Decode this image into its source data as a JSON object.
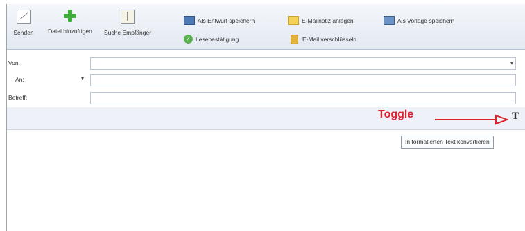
{
  "toolbar": {
    "send_label": "Senden",
    "attach_label": "Datei hinzufügen",
    "search_label": "Suche Empfänger",
    "save_draft_label": "Als Entwurf speichern",
    "read_receipt_label": "Lesebestätigung",
    "note_label": "E-Mailnotiz anlegen",
    "encrypt_label": "E-Mail verschlüsseln",
    "template_label": "Als Vorlage speichern"
  },
  "form": {
    "from_label": "Von:",
    "from_value": "",
    "to_label": "An:",
    "to_value": "",
    "subject_label": "Betreff:",
    "subject_value": ""
  },
  "annotation": {
    "toggle_label": "Toggle",
    "arrow_color": "#d9242f"
  },
  "format": {
    "icon": "text-format-icon",
    "icon_glyph": "T",
    "tooltip": "In formatierten Text konvertieren"
  },
  "icons": {
    "send": "send-icon",
    "attach": "plus-icon",
    "search": "address-book-icon",
    "save_draft": "save-draft-icon",
    "read_receipt": "check-icon",
    "note": "note-icon",
    "encrypt": "lock-icon",
    "template": "template-icon"
  }
}
